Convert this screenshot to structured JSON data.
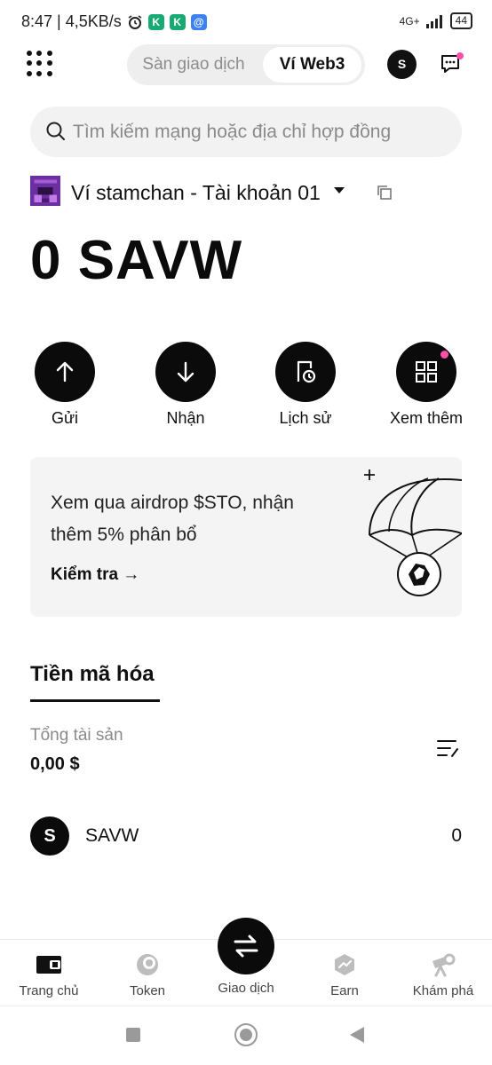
{
  "status_bar": {
    "time_speed": "8:47 | 4,5KB/s",
    "network": "4G+",
    "battery": "44"
  },
  "header": {
    "tab_exchange": "Sàn giao dịch",
    "tab_web3": "Ví Web3",
    "avatar_letter": "S"
  },
  "search": {
    "placeholder": "Tìm kiếm mạng hoặc địa chỉ hợp đồng"
  },
  "wallet": {
    "name": "Ví stamchan - Tài khoản 01",
    "balance": "0 SAVW"
  },
  "actions": [
    {
      "label": "Gửi",
      "icon": "arrow-up-icon"
    },
    {
      "label": "Nhận",
      "icon": "arrow-down-icon"
    },
    {
      "label": "Lịch sử",
      "icon": "history-icon"
    },
    {
      "label": "Xem thêm",
      "icon": "more-grid-icon"
    }
  ],
  "banner": {
    "text": "Xem qua airdrop $STO, nhận thêm 5% phân bổ",
    "cta": "Kiểm tra →"
  },
  "assets": {
    "tab_label": "Tiền mã hóa",
    "total_label": "Tổng tài sản",
    "total_value": "0,00 $",
    "tokens": [
      {
        "symbol_letter": "S",
        "name": "SAVW",
        "amount": "0"
      }
    ]
  },
  "bottom_nav": {
    "items": [
      {
        "label": "Trang chủ",
        "icon": "wallet-icon"
      },
      {
        "label": "Token",
        "icon": "token-icon"
      },
      {
        "label": "Giao dịch",
        "icon": "swap-icon"
      },
      {
        "label": "Earn",
        "icon": "earn-icon"
      },
      {
        "label": "Khám phá",
        "icon": "telescope-icon"
      }
    ]
  },
  "colors": {
    "accent_dark": "#0b0b0b",
    "notification_dot": "#ff4fa8",
    "muted_text": "#8a8a8a"
  }
}
